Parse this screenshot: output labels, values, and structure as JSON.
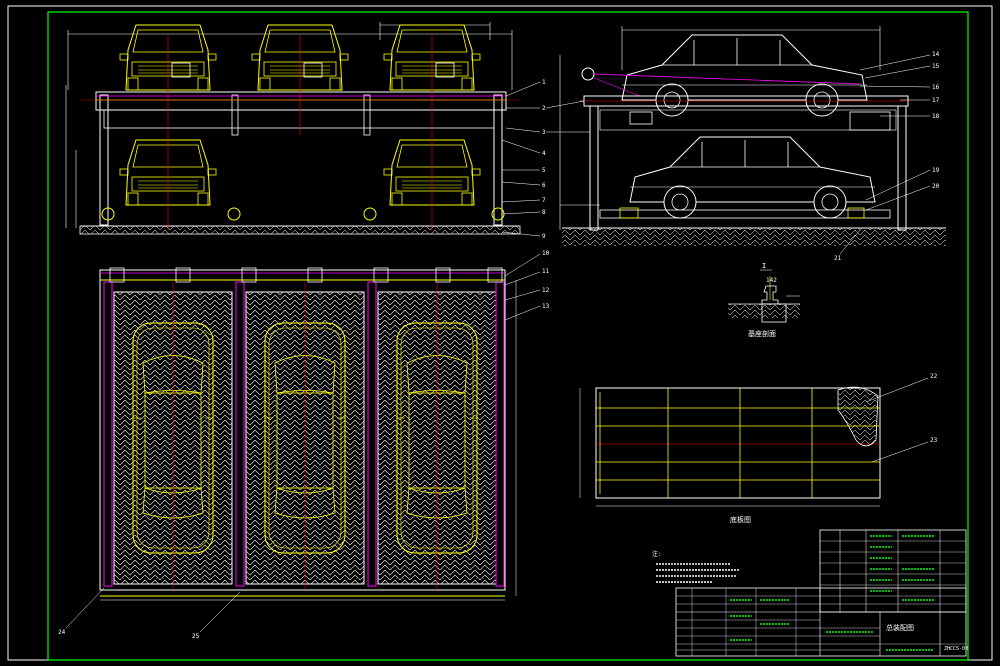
{
  "drawing": {
    "title_block_name": "总装配图",
    "drawing_code": "ZHCCS-00",
    "section_view_label": "基座剖面",
    "plan_label": "底板图",
    "section_mark": "I",
    "rail_dimension": "142",
    "notes_heading": "注:",
    "callouts_side": [
      "1",
      "2",
      "3",
      "4",
      "5",
      "6",
      "7",
      "8",
      "9",
      "10",
      "11",
      "12",
      "13"
    ],
    "callouts_right": [
      "14",
      "15",
      "16",
      "17",
      "18",
      "19",
      "20",
      "21"
    ],
    "callouts_plan": [
      "22",
      "23"
    ],
    "callouts_bottom": [
      "24",
      "25"
    ],
    "colors": {
      "frame": "#00ff00",
      "car": "#ffff00",
      "structure": "#ffffff",
      "centerline": "#ff0000",
      "accent": "#ff00ff",
      "dimension": "#00ffff"
    }
  }
}
